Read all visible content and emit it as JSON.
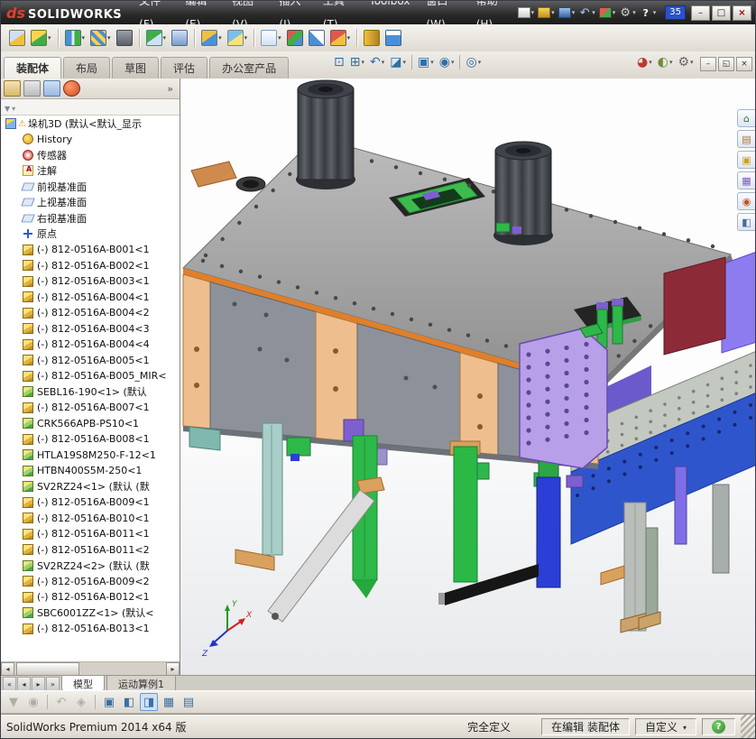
{
  "titlebar": {
    "logo_mark": "ds",
    "logo_text": "SOLIDWORKS",
    "menus": [
      {
        "label": "文件(F)"
      },
      {
        "label": "编辑(E)"
      },
      {
        "label": "视图(V)"
      },
      {
        "label": "插入(I)"
      },
      {
        "label": "工具(T)"
      },
      {
        "label": "Toolbox"
      },
      {
        "label": "窗口(W)"
      },
      {
        "label": "帮助(H)"
      }
    ],
    "quick_icons": [
      {
        "name": "new-document-icon",
        "cls": "qi-new",
        "dropdown": true
      },
      {
        "name": "open-icon",
        "cls": "qi-open",
        "dropdown": true
      },
      {
        "name": "save-icon",
        "cls": "qi-save",
        "dropdown": true
      },
      {
        "name": "undo-icon",
        "cls": "qi-undo",
        "dropdown": true
      },
      {
        "name": "rebuild-icon",
        "cls": "qi-rebuild",
        "dropdown": true
      },
      {
        "name": "options-icon",
        "cls": "qi-options",
        "dropdown": true
      },
      {
        "name": "help-icon",
        "cls": "qi-help",
        "dropdown": true
      }
    ],
    "ime_badge": "35",
    "window_buttons": [
      {
        "name": "minimize-button",
        "glyph": "–"
      },
      {
        "name": "maximize-button",
        "glyph": "□"
      },
      {
        "name": "close-button",
        "glyph": "×"
      }
    ]
  },
  "toolbar": {
    "icons": [
      {
        "name": "edit-component-icon",
        "cls": "tb-edit"
      },
      {
        "name": "insert-components-icon",
        "cls": "tb-insert",
        "dropdown": true
      },
      {
        "sep": true
      },
      {
        "name": "mate-icon",
        "cls": "tb-mate",
        "dropdown": true
      },
      {
        "name": "linear-component-pattern-icon",
        "cls": "tb-pattern",
        "dropdown": true
      },
      {
        "name": "smart-fasteners-icon",
        "cls": "tb-fastener"
      },
      {
        "sep": true
      },
      {
        "name": "move-component-icon",
        "cls": "tb-move",
        "dropdown": true
      },
      {
        "name": "show-hidden-components-icon",
        "cls": "tb-showhide"
      },
      {
        "sep": true
      },
      {
        "name": "assembly-features-icon",
        "cls": "tb-asmfeat",
        "dropdown": true
      },
      {
        "name": "reference-geometry-icon",
        "cls": "tb-refgeo",
        "dropdown": true
      },
      {
        "sep": true
      },
      {
        "name": "bill-of-materials-icon",
        "cls": "tb-bom",
        "dropdown": true
      },
      {
        "name": "exploded-view-icon",
        "cls": "tb-explode"
      },
      {
        "name": "explode-line-sketch-icon",
        "cls": "tb-explline"
      },
      {
        "name": "interference-detection-icon",
        "cls": "tb-interf",
        "dropdown": true
      },
      {
        "sep": true
      },
      {
        "name": "measure-icon",
        "cls": "tb-measure"
      },
      {
        "name": "mass-properties-icon",
        "cls": "tb-window"
      }
    ]
  },
  "command_tabs": {
    "tabs": [
      {
        "label": "装配体",
        "active": true
      },
      {
        "label": "布局"
      },
      {
        "label": "草图"
      },
      {
        "label": "评估"
      },
      {
        "label": "办公室产品"
      }
    ]
  },
  "headsup": {
    "group1": [
      {
        "name": "zoom-to-fit-icon",
        "cls": "h-zoomfit"
      },
      {
        "name": "zoom-to-area-icon",
        "cls": "h-zoomarea",
        "dropdown": true
      },
      {
        "name": "previous-view-icon",
        "cls": "h-prev",
        "dropdown": true
      },
      {
        "name": "section-view-icon",
        "cls": "h-section",
        "dropdown": true
      },
      {
        "sep": true
      },
      {
        "name": "view-orientation-icon",
        "cls": "h-orient",
        "dropdown": true
      },
      {
        "name": "display-style-icon",
        "cls": "h-display",
        "dropdown": true
      },
      {
        "sep": true
      },
      {
        "name": "hide-show-items-icon",
        "cls": "h-hideshow",
        "dropdown": true
      }
    ],
    "group2": [
      {
        "name": "edit-appearance-icon",
        "cls": "h-appearance",
        "dropdown": true
      },
      {
        "name": "apply-scene-icon",
        "cls": "h-scene",
        "dropdown": true
      },
      {
        "name": "view-settings-icon",
        "cls": "h-viewset",
        "dropdown": true
      }
    ]
  },
  "doc_window_buttons": [
    {
      "name": "minimize-document-icon",
      "glyph": "–"
    },
    {
      "name": "restore-document-icon",
      "glyph": "◱"
    },
    {
      "name": "close-document-icon",
      "glyph": "×"
    }
  ],
  "task_pane": {
    "icons": [
      {
        "name": "solidworks-resources-icon",
        "cls": "tp-home"
      },
      {
        "name": "design-library-icon",
        "cls": "tp-library"
      },
      {
        "name": "file-explorer-icon",
        "cls": "tp-explorer"
      },
      {
        "name": "view-palette-icon",
        "cls": "tp-palette"
      },
      {
        "name": "appearances-icon",
        "cls": "tp-appearance"
      },
      {
        "name": "custom-properties-icon",
        "cls": "tp-decals"
      }
    ]
  },
  "feature_tree": {
    "panel_tabs": [
      {
        "name": "featuremanager-tab-icon",
        "cls": "ht-tree"
      },
      {
        "name": "propertymanager-tab-icon",
        "cls": "ht-prop"
      },
      {
        "name": "configurationmanager-tab-icon",
        "cls": "ht-config"
      },
      {
        "name": "appearances-tab-icon",
        "cls": "ht-appearance"
      }
    ],
    "root_label": "垛机3D (默认<默认_显示",
    "items": [
      {
        "icon": "history",
        "label": "History"
      },
      {
        "icon": "sensor",
        "label": "传感器"
      },
      {
        "icon": "annotation",
        "label": "注解"
      },
      {
        "icon": "plane",
        "label": "前视基准面"
      },
      {
        "icon": "plane",
        "label": "上视基准面"
      },
      {
        "icon": "plane",
        "label": "右视基准面"
      },
      {
        "icon": "origin",
        "label": "原点"
      },
      {
        "icon": "part",
        "label": "(-) 812-0516A-B001<1"
      },
      {
        "icon": "part",
        "label": "(-) 812-0516A-B002<1"
      },
      {
        "icon": "part",
        "label": "(-) 812-0516A-B003<1"
      },
      {
        "icon": "part",
        "label": "(-) 812-0516A-B004<1"
      },
      {
        "icon": "part",
        "label": "(-) 812-0516A-B004<2"
      },
      {
        "icon": "part",
        "label": "(-) 812-0516A-B004<3"
      },
      {
        "icon": "part",
        "label": "(-) 812-0516A-B004<4"
      },
      {
        "icon": "part",
        "label": "(-) 812-0516A-B005<1"
      },
      {
        "icon": "part",
        "label": "(-) 812-0516A-B005_MIR<"
      },
      {
        "icon": "asm",
        "label": "SEBL16-190<1> (默认"
      },
      {
        "icon": "part",
        "label": "(-) 812-0516A-B007<1"
      },
      {
        "icon": "asm",
        "label": "CRK566APB-PS10<1"
      },
      {
        "icon": "part",
        "label": "(-) 812-0516A-B008<1"
      },
      {
        "icon": "asm",
        "label": "HTLA19S8M250-F-12<1"
      },
      {
        "icon": "asm",
        "label": "HTBN400S5M-250<1"
      },
      {
        "icon": "asm",
        "label": "SV2RZ24<1> (默认 (默"
      },
      {
        "icon": "part",
        "label": "(-) 812-0516A-B009<1"
      },
      {
        "icon": "part",
        "label": "(-) 812-0516A-B010<1"
      },
      {
        "icon": "part",
        "label": "(-) 812-0516A-B011<1"
      },
      {
        "icon": "part",
        "label": "(-) 812-0516A-B011<2"
      },
      {
        "icon": "asm",
        "label": "SV2RZ24<2> (默认 (默"
      },
      {
        "icon": "part",
        "label": "(-) 812-0516A-B009<2"
      },
      {
        "icon": "part",
        "label": "(-) 812-0516A-B012<1"
      },
      {
        "icon": "asm",
        "label": "SBC6001ZZ<1> (默认<"
      },
      {
        "icon": "part",
        "label": "(-) 812-0516A-B013<1"
      }
    ]
  },
  "model_tabs": {
    "nav": [
      {
        "name": "scroll-tabs-start-button",
        "glyph": "«"
      },
      {
        "name": "scroll-tabs-left-button",
        "glyph": "◂"
      },
      {
        "name": "scroll-tabs-right-button",
        "glyph": "▸"
      },
      {
        "name": "scroll-tabs-end-button",
        "glyph": "»"
      }
    ],
    "tabs": [
      {
        "label": "模型",
        "active": true
      },
      {
        "label": "运动算例1"
      }
    ]
  },
  "bottom_toolbar": {
    "icons": [
      {
        "name": "selection-filter-icon",
        "cls": "bt-filter",
        "disabled": true
      },
      {
        "name": "magnifier-icon",
        "cls": "bt-mag",
        "disabled": true
      },
      {
        "sep": true
      },
      {
        "name": "previous-view-icon",
        "cls": "bt-prev",
        "disabled": true
      },
      {
        "name": "3d-drawing-view-icon",
        "cls": "bt-3dv",
        "disabled": true
      },
      {
        "sep": true
      },
      {
        "name": "view-orientation-icon",
        "cls": "bt-orient"
      },
      {
        "name": "shaded-with-edges-icon",
        "cls": "bt-shaded"
      },
      {
        "name": "isometric-view-icon",
        "cls": "bt-iso",
        "selected": true
      },
      {
        "name": "view-selector-icon",
        "cls": "bt-selector"
      },
      {
        "name": "grid-icon",
        "cls": "bt-grid"
      }
    ]
  },
  "statusbar": {
    "product": "SolidWorks Premium 2014 x64 版",
    "definition_state": "完全定义",
    "editing_state": "在编辑 装配体",
    "custom_label": "自定义"
  },
  "triad": {
    "x": "X",
    "y": "Y",
    "z": "Z"
  },
  "model_colors": {
    "plate": "#a9a9a9",
    "edge_orange": "#e07f2a",
    "panel_orange": "#eebe8e",
    "panel_gray": "#8d929a",
    "cylinder_dark": "#41454c",
    "slide_green": "#2db84a",
    "slide_teal": "#a9cdc7",
    "slide_blue": "#2b3fd6",
    "table_top": "#c3c9c0",
    "table_blue": "#2f55cc",
    "gusset_purple": "#b7a0e8",
    "wall_maroon": "#8c2a38",
    "violet": "#8d7cf0",
    "arm_gray": "#dcdcdc",
    "arm_black": "#161616",
    "tan": "#d9a05e"
  }
}
